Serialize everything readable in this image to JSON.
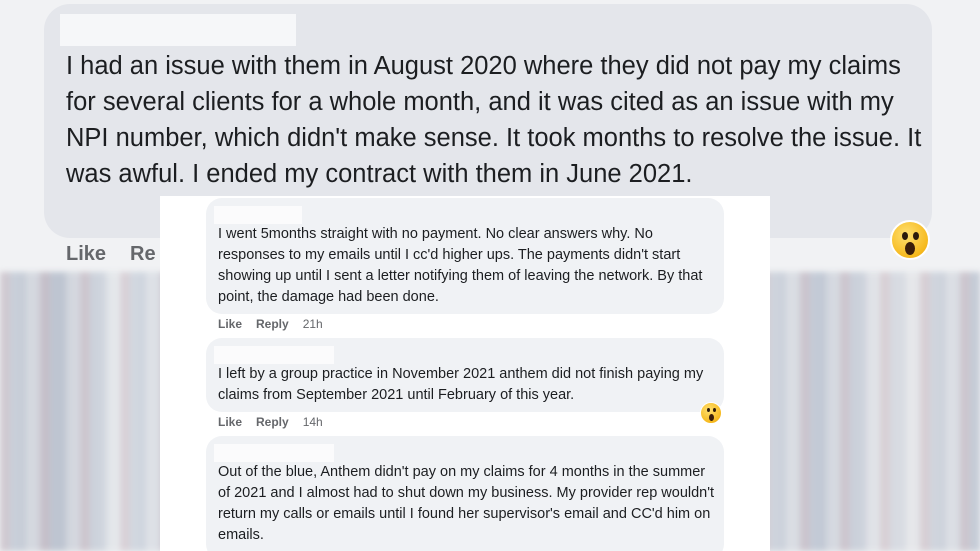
{
  "main_comment": {
    "text": "I had an issue with them in August 2020 where they did not pay my claims for several clients for a whole month, and it was cited as an issue with my NPI number, which didn't make sense. It took months to resolve the issue. It was awful. I ended my contract with them in June 2021.",
    "like_label": "Like",
    "reply_label": "Re",
    "reaction_icon": "wow-emoji-icon"
  },
  "replies": [
    {
      "text": "I went 5months straight with no payment. No clear answers why. No responses to my emails until I cc'd higher ups. The payments didn't start showing up until I sent a letter notifying them of leaving the network. By that point, the damage had been done.",
      "like_label": "Like",
      "reply_label": "Reply",
      "time": "21h"
    },
    {
      "text": "I left by a group practice in November 2021 anthem did not finish paying my claims from September 2021 until February of this year.",
      "like_label": "Like",
      "reply_label": "Reply",
      "time": "14h",
      "reaction_icon": "wow-emoji-icon"
    },
    {
      "text": "Out of the blue, Anthem didn't pay on my claims for 4 months in the summer of 2021 and I almost had to shut down my business. My provider rep wouldn't return my calls or emails until I found her supervisor's email and CC'd him on emails."
    }
  ]
}
